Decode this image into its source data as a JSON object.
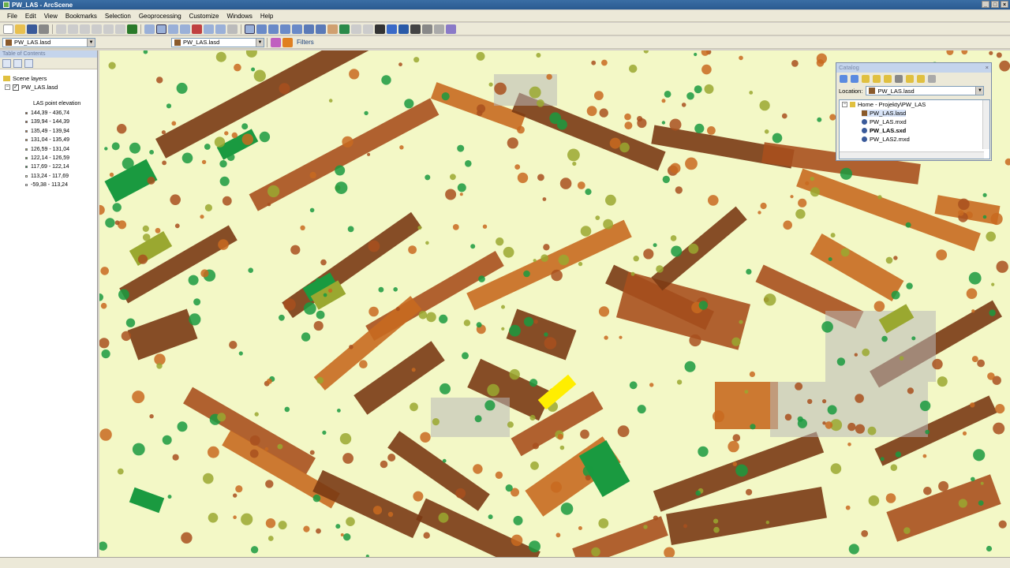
{
  "window": {
    "title": "PW_LAS - ArcScene"
  },
  "menu": [
    "File",
    "Edit",
    "View",
    "Bookmarks",
    "Selection",
    "Geoprocessing",
    "Customize",
    "Windows",
    "Help"
  ],
  "toolbar": {
    "layer_combo_1": "PW_LAS.lasd",
    "layer_combo_2": "PW_LAS.lasd",
    "filters_label": "Filters"
  },
  "toc": {
    "title": "Table of Contents",
    "root": "Scene layers",
    "layer": "PW_LAS.lasd",
    "legend_title": "LAS point elevation",
    "legend": [
      {
        "label": "144,39 - 436,74",
        "color": "#8b4a1c"
      },
      {
        "label": "139,94 - 144,39",
        "color": "#a8501e"
      },
      {
        "label": "135,49 - 139,94",
        "color": "#c86a20"
      },
      {
        "label": "131,04 - 135,49",
        "color": "#d89030"
      },
      {
        "label": "126,59 - 131,04",
        "color": "#9aa830"
      },
      {
        "label": "122,14 - 126,59",
        "color": "#4c9a2a"
      },
      {
        "label": "117,69 - 122,14",
        "color": "#1a9a40"
      },
      {
        "label": "113,24 - 117,69",
        "color": "#f0f6c0"
      },
      {
        "label": "-59,38 - 113,24",
        "color": "#ffffff"
      }
    ]
  },
  "catalog": {
    "title": "Catalog",
    "location_label": "Location:",
    "location_value": "PW_LAS.lasd",
    "items": [
      {
        "label": "Home - Projekty\\PW_LAS",
        "bold": false
      },
      {
        "label": "PW_LAS.lasd",
        "bold": false
      },
      {
        "label": "PW_LAS.mxd",
        "bold": false
      },
      {
        "label": "PW_LAS.sxd",
        "bold": true
      },
      {
        "label": "PW_LAS2.mxd",
        "bold": false
      }
    ]
  },
  "colors": {
    "ground": "#f3f8c6",
    "building_dark": "#7a3a14",
    "building_mid": "#a8501e",
    "roof_orange": "#c86a20",
    "tree_green": "#1a9a40",
    "grass_olive": "#9aa830",
    "selection": "#ffee00",
    "grey": "#b8b8b8"
  }
}
